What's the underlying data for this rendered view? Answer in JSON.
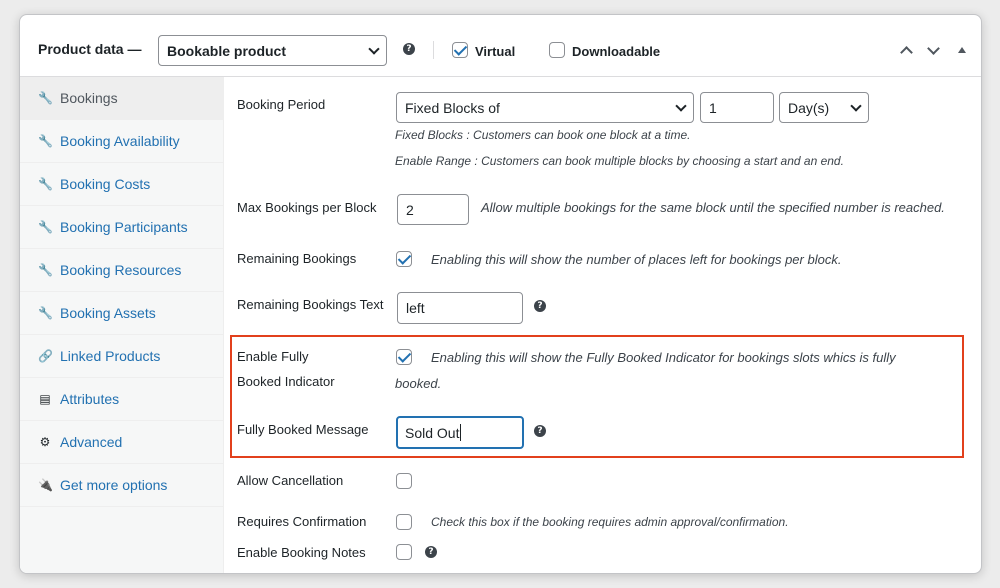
{
  "header": {
    "title": "Product data —",
    "product_type": "Bookable product",
    "virtual_label": "Virtual",
    "virtual_checked": true,
    "downloadable_label": "Downloadable",
    "downloadable_checked": false,
    "help_glyph": "?"
  },
  "sidebar": {
    "items": [
      {
        "label": "Bookings",
        "icon": "wrench-icon",
        "glyph": "🔧",
        "active": true
      },
      {
        "label": "Booking Availability",
        "icon": "wrench-icon",
        "glyph": "🔧"
      },
      {
        "label": "Booking Costs",
        "icon": "wrench-icon",
        "glyph": "🔧"
      },
      {
        "label": "Booking Participants",
        "icon": "wrench-icon",
        "glyph": "🔧"
      },
      {
        "label": "Booking Resources",
        "icon": "wrench-icon",
        "glyph": "🔧"
      },
      {
        "label": "Booking Assets",
        "icon": "wrench-icon",
        "glyph": "🔧"
      },
      {
        "label": "Linked Products",
        "icon": "link-icon",
        "glyph": "🔗"
      },
      {
        "label": "Attributes",
        "icon": "list-icon",
        "glyph": "▤"
      },
      {
        "label": "Advanced",
        "icon": "gear-icon",
        "glyph": "⚙"
      },
      {
        "label": "Get more options",
        "icon": "plugin-icon",
        "glyph": "🔌"
      }
    ]
  },
  "form": {
    "booking_period": {
      "label": "Booking Period",
      "type_value": "Fixed Blocks of",
      "number_value": "1",
      "unit_value": "Day(s)",
      "desc_1": "Fixed Blocks : Customers can book one block at a time.",
      "desc_2": "Enable Range : Customers can book multiple blocks by choosing a start and an end."
    },
    "max_bookings": {
      "label": "Max Bookings per Block",
      "value": "2",
      "desc": "Allow multiple bookings for the same block until the specified number is reached."
    },
    "remaining_bookings": {
      "label": "Remaining Bookings",
      "checked": true,
      "desc": "Enabling this will show the number of places left for bookings per block."
    },
    "remaining_text": {
      "label": "Remaining Bookings Text",
      "value": "left"
    },
    "fully_booked_indicator": {
      "label_1": "Enable Fully",
      "label_2": "Booked Indicator",
      "checked": true,
      "desc_1": "Enabling this will show the Fully Booked Indicator for bookings slots whics is fully",
      "desc_2": "booked."
    },
    "fully_booked_message": {
      "label": "Fully Booked Message",
      "value": "Sold Out"
    },
    "allow_cancellation": {
      "label": "Allow Cancellation",
      "checked": false
    },
    "requires_confirmation": {
      "label": "Requires Confirmation",
      "checked": false,
      "desc": "Check this box if the booking requires admin approval/confirmation."
    },
    "booking_notes": {
      "label": "Enable Booking Notes",
      "checked": false
    }
  },
  "colors": {
    "link": "#2271b1",
    "highlight": "#e2401c"
  }
}
